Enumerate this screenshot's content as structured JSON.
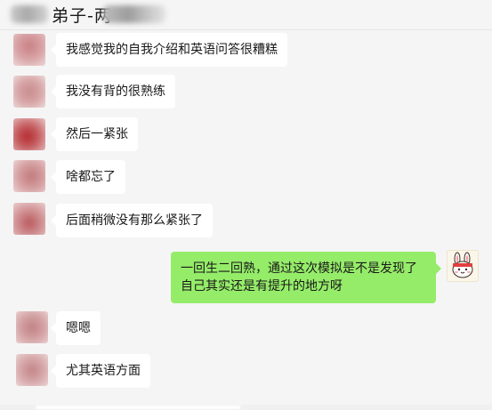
{
  "window": {
    "title_visible": "弟子-两"
  },
  "messages": [
    {
      "side": "left",
      "text": "我感觉我的自我介绍和英语问答很糟糕"
    },
    {
      "side": "left",
      "text": "我没有背的很熟练"
    },
    {
      "side": "left",
      "text": "然后一紧张"
    },
    {
      "side": "left",
      "text": "啥都忘了"
    },
    {
      "side": "left",
      "text": "后面稍微没有那么紧张了"
    },
    {
      "side": "right",
      "text": "一回生二回熟，通过这次模拟是不是发现了自己其实还是有提升的地方呀"
    },
    {
      "side": "left",
      "text": "嗯嗯"
    },
    {
      "side": "left",
      "text": "尤其英语方面"
    }
  ],
  "colors": {
    "background": "#f5f5f5",
    "incoming_bubble": "#ffffff",
    "outgoing_bubble": "#95ec69",
    "text": "#191919"
  }
}
